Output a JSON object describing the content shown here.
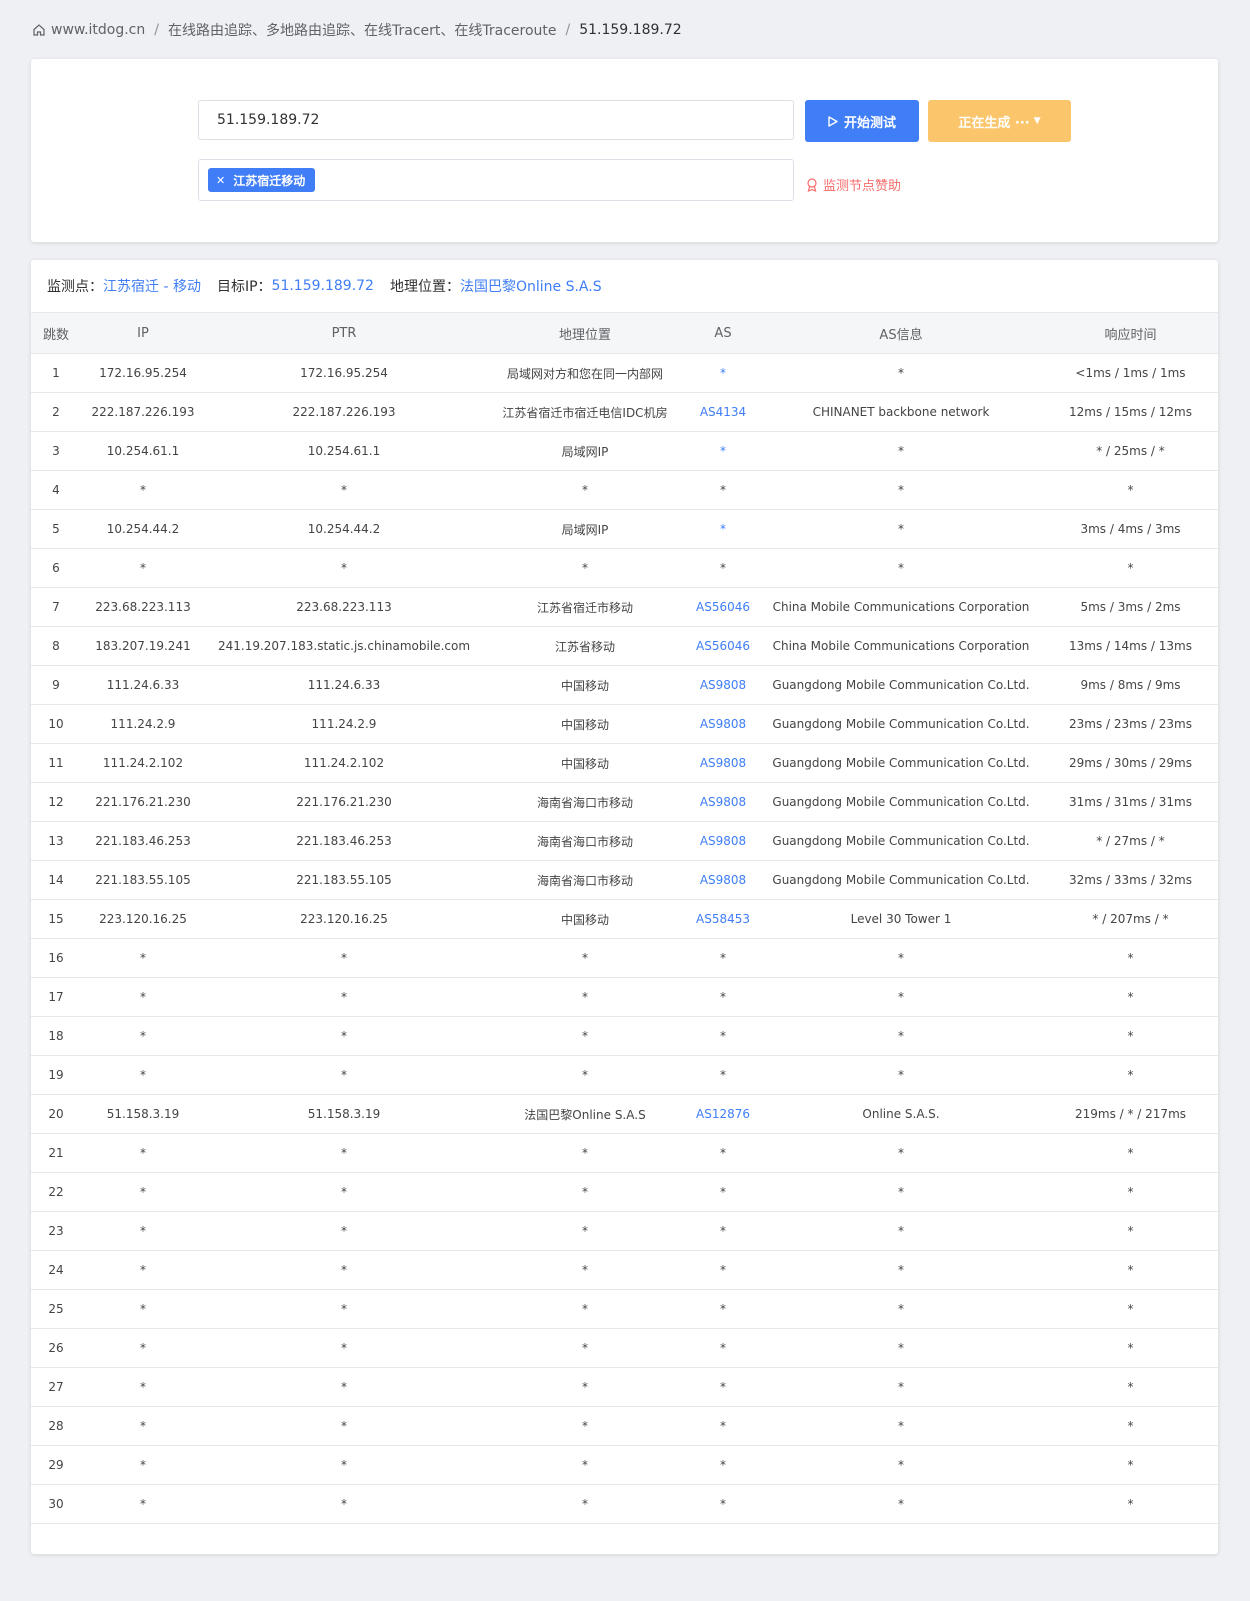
{
  "breadcrumb": {
    "home": "www.itdog.cn",
    "section": "在线路由追踪、多地路由追踪、在线Tracert、在线Traceroute",
    "current": "51.159.189.72"
  },
  "form": {
    "target_value": "51.159.189.72",
    "start_label": "开始测试",
    "generate_label": "正在生成 ···",
    "selected_node": "江苏宿迁移动",
    "sponsor_label": "监测节点赞助"
  },
  "info": {
    "monitor_label": "监测点：",
    "monitor_value": "江苏宿迁 - 移动",
    "target_label": "目标IP：",
    "target_value": "51.159.189.72",
    "geo_label": "地理位置：",
    "geo_value": "法国巴黎Online S.A.S"
  },
  "table": {
    "headers": [
      "跳数",
      "IP",
      "PTR",
      "地理位置",
      "AS",
      "AS信息",
      "响应时间"
    ],
    "rows": [
      [
        "1",
        "172.16.95.254",
        "172.16.95.254",
        "局域网对方和您在同一内部网",
        "*",
        "*",
        "<1ms / 1ms / 1ms"
      ],
      [
        "2",
        "222.187.226.193",
        "222.187.226.193",
        "江苏省宿迁市宿迁电信IDC机房",
        "AS4134",
        "CHINANET backbone network",
        "12ms / 15ms / 12ms"
      ],
      [
        "3",
        "10.254.61.1",
        "10.254.61.1",
        "局域网IP",
        "*",
        "*",
        "* / 25ms / *"
      ],
      [
        "4",
        "*",
        "*",
        "*",
        "*",
        "*",
        "*"
      ],
      [
        "5",
        "10.254.44.2",
        "10.254.44.2",
        "局域网IP",
        "*",
        "*",
        "3ms / 4ms / 3ms"
      ],
      [
        "6",
        "*",
        "*",
        "*",
        "*",
        "*",
        "*"
      ],
      [
        "7",
        "223.68.223.113",
        "223.68.223.113",
        "江苏省宿迁市移动",
        "AS56046",
        "China Mobile Communications Corporation",
        "5ms / 3ms / 2ms"
      ],
      [
        "8",
        "183.207.19.241",
        "241.19.207.183.static.js.chinamobile.com",
        "江苏省移动",
        "AS56046",
        "China Mobile Communications Corporation",
        "13ms / 14ms / 13ms"
      ],
      [
        "9",
        "111.24.6.33",
        "111.24.6.33",
        "中国移动",
        "AS9808",
        "Guangdong Mobile Communication Co.Ltd.",
        "9ms / 8ms / 9ms"
      ],
      [
        "10",
        "111.24.2.9",
        "111.24.2.9",
        "中国移动",
        "AS9808",
        "Guangdong Mobile Communication Co.Ltd.",
        "23ms / 23ms / 23ms"
      ],
      [
        "11",
        "111.24.2.102",
        "111.24.2.102",
        "中国移动",
        "AS9808",
        "Guangdong Mobile Communication Co.Ltd.",
        "29ms / 30ms / 29ms"
      ],
      [
        "12",
        "221.176.21.230",
        "221.176.21.230",
        "海南省海口市移动",
        "AS9808",
        "Guangdong Mobile Communication Co.Ltd.",
        "31ms / 31ms / 31ms"
      ],
      [
        "13",
        "221.183.46.253",
        "221.183.46.253",
        "海南省海口市移动",
        "AS9808",
        "Guangdong Mobile Communication Co.Ltd.",
        "* / 27ms / *"
      ],
      [
        "14",
        "221.183.55.105",
        "221.183.55.105",
        "海南省海口市移动",
        "AS9808",
        "Guangdong Mobile Communication Co.Ltd.",
        "32ms / 33ms / 32ms"
      ],
      [
        "15",
        "223.120.16.25",
        "223.120.16.25",
        "中国移动",
        "AS58453",
        "Level 30 Tower 1",
        "* / 207ms / *"
      ],
      [
        "16",
        "*",
        "*",
        "*",
        "*",
        "*",
        "*"
      ],
      [
        "17",
        "*",
        "*",
        "*",
        "*",
        "*",
        "*"
      ],
      [
        "18",
        "*",
        "*",
        "*",
        "*",
        "*",
        "*"
      ],
      [
        "19",
        "*",
        "*",
        "*",
        "*",
        "*",
        "*"
      ],
      [
        "20",
        "51.158.3.19",
        "51.158.3.19",
        "法国巴黎Online S.A.S",
        "AS12876",
        "Online S.A.S.",
        "219ms / * / 217ms"
      ],
      [
        "21",
        "*",
        "*",
        "*",
        "*",
        "*",
        "*"
      ],
      [
        "22",
        "*",
        "*",
        "*",
        "*",
        "*",
        "*"
      ],
      [
        "23",
        "*",
        "*",
        "*",
        "*",
        "*",
        "*"
      ],
      [
        "24",
        "*",
        "*",
        "*",
        "*",
        "*",
        "*"
      ],
      [
        "25",
        "*",
        "*",
        "*",
        "*",
        "*",
        "*"
      ],
      [
        "26",
        "*",
        "*",
        "*",
        "*",
        "*",
        "*"
      ],
      [
        "27",
        "*",
        "*",
        "*",
        "*",
        "*",
        "*"
      ],
      [
        "28",
        "*",
        "*",
        "*",
        "*",
        "*",
        "*"
      ],
      [
        "29",
        "*",
        "*",
        "*",
        "*",
        "*",
        "*"
      ],
      [
        "30",
        "*",
        "*",
        "*",
        "*",
        "*",
        "*"
      ]
    ],
    "as_link_rows": [
      1,
      2,
      3,
      5,
      7,
      8,
      9,
      10,
      11,
      12,
      13,
      14,
      15,
      20
    ]
  },
  "colors": {
    "accent": "#3f7ef7",
    "warning": "#fbc56b",
    "danger": "#f56c6c",
    "background": "#eef0f4"
  },
  "icons": {
    "home": "home-icon",
    "play": "play-icon",
    "caret": "caret-down-icon",
    "close": "tag-close-icon",
    "award": "award-icon"
  }
}
